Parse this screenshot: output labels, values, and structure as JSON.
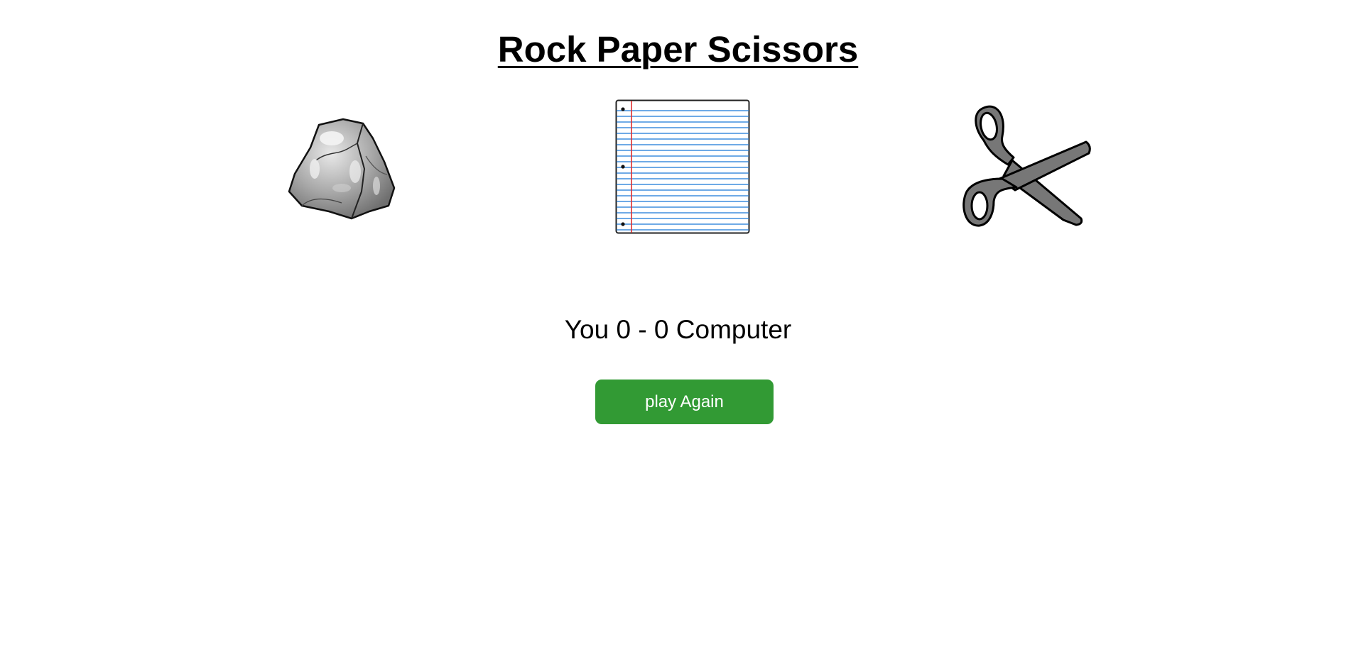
{
  "title": "Rock Paper Scissors",
  "choices": [
    {
      "id": "rock",
      "icon": "rock-icon"
    },
    {
      "id": "paper",
      "icon": "paper-icon"
    },
    {
      "id": "scissors",
      "icon": "scissors-icon"
    }
  ],
  "score": {
    "text": "You 0 - 0 Computer",
    "you": 0,
    "computer": 0
  },
  "play_again": {
    "label": "play Again",
    "color": "#329a34"
  }
}
